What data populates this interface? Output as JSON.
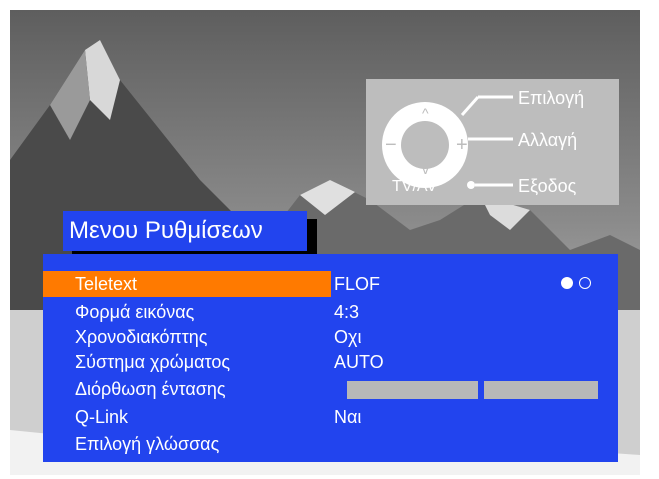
{
  "help_box": {
    "select_label": "Επιλογή",
    "change_label": "Αλλαγή",
    "exit_label": "Εξοδος",
    "tvav_label": "TV/AV",
    "up_symbol": "^",
    "down_symbol": "v",
    "minus_symbol": "−",
    "plus_symbol": "+"
  },
  "menu": {
    "title": "Μενου Ρυθμίσεων",
    "items": [
      {
        "label": "Teletext",
        "value": "FLOF",
        "selected": true,
        "indicator": [
          "filled",
          "empty"
        ]
      },
      {
        "label": "Φορμά εικόνας",
        "value": "4:3"
      },
      {
        "label": "Χρονοδιακόπτης",
        "value": "Οχι"
      },
      {
        "label": "Σύστημα χρώματος",
        "value": "AUTO"
      },
      {
        "label": "Διόρθωση έντασης",
        "value": "",
        "bars": 2
      },
      {
        "label": "Q-Link",
        "value": "Ναι"
      },
      {
        "label": "Επιλογή γλώσσας",
        "value": ""
      }
    ]
  },
  "colors": {
    "panel": "#2244ee",
    "highlight": "#ff7a00",
    "help_box": "#bdbdbd",
    "text": "#ffffff"
  }
}
